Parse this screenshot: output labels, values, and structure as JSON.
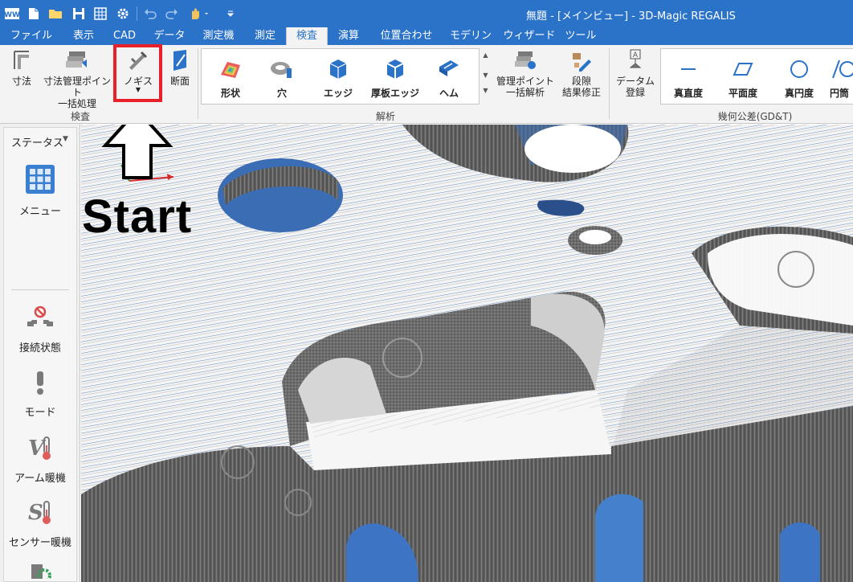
{
  "app": {
    "title": "無題 - [メインビュー] - 3D-Magic REGALIS"
  },
  "quick_access": {
    "icons": [
      "app-logo-icon",
      "new-file-icon",
      "open-folder-icon",
      "save-icon",
      "grid-icon",
      "gear-icon",
      "undo-icon",
      "redo-icon",
      "hand-icon",
      "customize-icon"
    ]
  },
  "tabs": [
    {
      "label": "ファイル",
      "active": false
    },
    {
      "label": "表示",
      "active": false
    },
    {
      "label": "CAD",
      "active": false
    },
    {
      "label": "データ",
      "active": false
    },
    {
      "label": "測定機",
      "active": false
    },
    {
      "label": "測定",
      "active": false
    },
    {
      "label": "検査",
      "active": true
    },
    {
      "label": "演算",
      "active": false
    },
    {
      "label": "位置合わせ",
      "active": false
    },
    {
      "label": "モデリング",
      "active": false
    },
    {
      "label": "ウィザード",
      "active": false
    },
    {
      "label": "ツール",
      "active": false
    }
  ],
  "ribbon": {
    "inspect": {
      "dimension": "寸法",
      "batch_line1": "寸法管理ポイント",
      "batch_line2": "一括処理",
      "caliper": "ノギス",
      "section": "断面",
      "group_label": "検査"
    },
    "analysis": {
      "shape": "形状",
      "hole": "穴",
      "edge": "エッジ",
      "thick_edge": "厚板エッジ",
      "hem": "ヘム",
      "mgmt_line1": "管理ポイント",
      "mgmt_line2": "一括解析",
      "step_line1": "段隙",
      "step_line2": "結果修正",
      "group_label": "解析"
    },
    "gdt": {
      "datum_line1": "データム",
      "datum_line2": "登録",
      "straightness": "真直度",
      "flatness": "平面度",
      "circularity": "真円度",
      "cylindricity": "円筒",
      "group_label": "幾何公差(GD&T)"
    }
  },
  "status_panel": {
    "title": "ステータス",
    "items": {
      "menu": "メニュー",
      "connection": "接続状態",
      "mode": "モード",
      "arm_warmup": "アーム暖機",
      "sensor_warmup": "センサー暖機"
    }
  },
  "annotation": {
    "start_text": "Start"
  },
  "colors": {
    "title_bar": "#2b73c9",
    "highlight": "#e8202a",
    "ribbon_bg": "#f3f3f3"
  }
}
